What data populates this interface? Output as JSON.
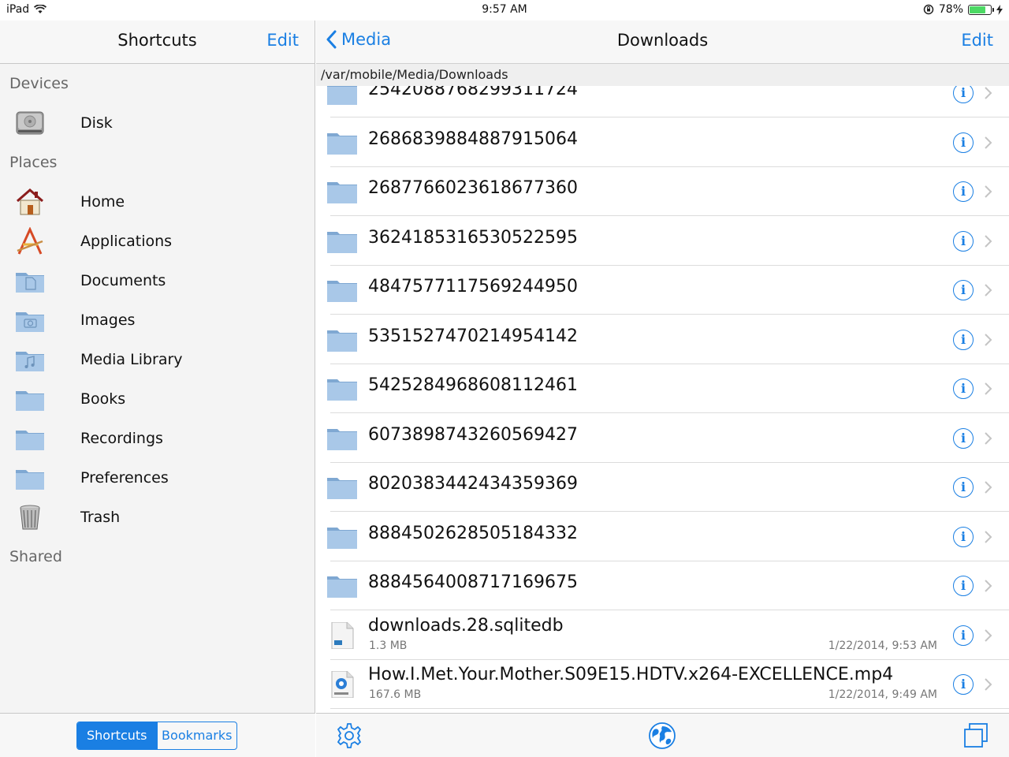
{
  "status_bar": {
    "device": "iPad",
    "time": "9:57 AM",
    "battery_percent": "78%",
    "battery_level": 0.78
  },
  "sidebar": {
    "title": "Shortcuts",
    "edit_label": "Edit",
    "sections": {
      "devices": "Devices",
      "places": "Places",
      "shared": "Shared"
    },
    "devices": [
      {
        "label": "Disk",
        "icon": "disk-icon"
      }
    ],
    "places": [
      {
        "label": "Home",
        "icon": "home-icon"
      },
      {
        "label": "Applications",
        "icon": "applications-icon"
      },
      {
        "label": "Documents",
        "icon": "documents-folder-icon"
      },
      {
        "label": "Images",
        "icon": "images-folder-icon"
      },
      {
        "label": "Media Library",
        "icon": "music-folder-icon"
      },
      {
        "label": "Books",
        "icon": "folder-icon"
      },
      {
        "label": "Recordings",
        "icon": "folder-icon"
      },
      {
        "label": "Preferences",
        "icon": "folder-icon"
      },
      {
        "label": "Trash",
        "icon": "trash-icon"
      }
    ],
    "segments": {
      "shortcuts": "Shortcuts",
      "bookmarks": "Bookmarks"
    }
  },
  "main": {
    "back_label": "Media",
    "title": "Downloads",
    "edit_label": "Edit",
    "path": "/var/mobile/Media/Downloads",
    "items": [
      {
        "name": "2542088768299311724",
        "type": "folder"
      },
      {
        "name": "2686839884887915064",
        "type": "folder"
      },
      {
        "name": "2687766023618677360",
        "type": "folder"
      },
      {
        "name": "3624185316530522595",
        "type": "folder"
      },
      {
        "name": "4847577117569244950",
        "type": "folder"
      },
      {
        "name": "5351527470214954142",
        "type": "folder"
      },
      {
        "name": "5425284968608112461",
        "type": "folder"
      },
      {
        "name": "6073898743260569427",
        "type": "folder"
      },
      {
        "name": "8020383442434359369",
        "type": "folder"
      },
      {
        "name": "8884502628505184332",
        "type": "folder"
      },
      {
        "name": "8884564008717169675",
        "type": "folder"
      },
      {
        "name": "downloads.28.sqlitedb",
        "type": "sqlite",
        "size": "1.3 MB",
        "date": "1/22/2014, 9:53 AM"
      },
      {
        "name": "How.I.Met.Your.Mother.S09E15.HDTV.x264-EXCELLENCE.mp4",
        "type": "movie",
        "size": "167.6 MB",
        "date": "1/22/2014, 9:49 AM"
      }
    ],
    "toolbar": {
      "left": "gear-icon",
      "center": "globe-icon",
      "right": "windows-icon"
    }
  },
  "colors": {
    "accent": "#1a7fe3",
    "folder": "#8fb5da"
  }
}
